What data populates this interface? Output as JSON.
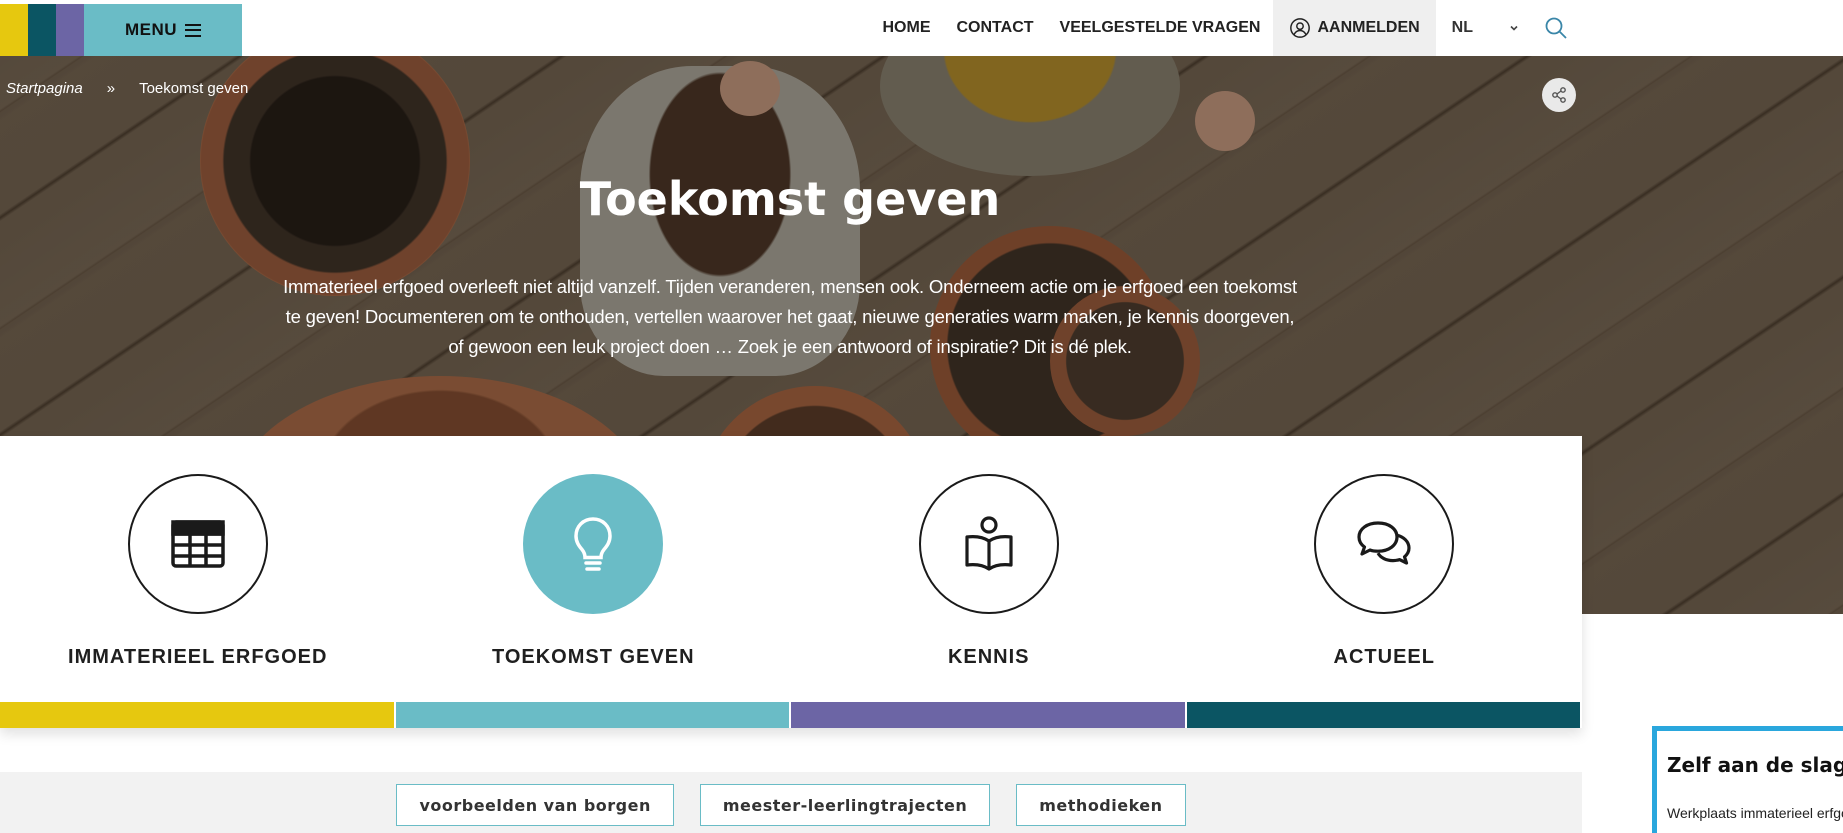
{
  "colors": {
    "yellow": "#e6c80f",
    "teal_dark": "#0b5563",
    "purple": "#6c65a5",
    "teal_light": "#6abcc6",
    "side_card_border": "#2aa7dd"
  },
  "header": {
    "menu_label": "MENU",
    "nav": {
      "home": "HOME",
      "contact": "CONTACT",
      "faq": "VEELGESTELDE VRAGEN",
      "login": "AANMELDEN",
      "language": "NL"
    },
    "icons": {
      "menu": "hamburger-icon",
      "login": "user-circle-icon",
      "language": "chevron-down-icon",
      "search": "search-icon"
    }
  },
  "breadcrumb": {
    "home": "Startpagina",
    "separator": "»",
    "current": "Toekomst geven"
  },
  "hero": {
    "title": "Toekomst geven",
    "intro": "Immaterieel erfgoed overleeft niet altijd vanzelf. Tijden veranderen, mensen ook. Onderneem actie om je erfgoed een toekomst te geven! Documenteren om te onthouden, vertellen waarover het gaat, nieuwe generaties warm maken, je kennis doorgeven, of gewoon een leuk project doen … Zoek je een antwoord of inspiratie? Dit is dé plek.",
    "share_icon": "share-icon"
  },
  "categories": [
    {
      "label": "IMMATERIEEL ERFGOED",
      "icon": "grid-icon",
      "color": "#e6c80f",
      "active": false
    },
    {
      "label": "TOEKOMST GEVEN",
      "icon": "lightbulb-icon",
      "color": "#6abcc6",
      "active": true
    },
    {
      "label": "KENNIS",
      "icon": "reading-person-icon",
      "color": "#6c65a5",
      "active": false
    },
    {
      "label": "ACTUEEL",
      "icon": "speech-bubbles-icon",
      "color": "#0b5563",
      "active": false
    }
  ],
  "tags": [
    "voorbeelden van borgen",
    "meester-leerlingtrajecten",
    "methodieken"
  ],
  "side_card": {
    "title": "Zelf aan de slag",
    "text": "Werkplaats immaterieel erfgoed"
  }
}
